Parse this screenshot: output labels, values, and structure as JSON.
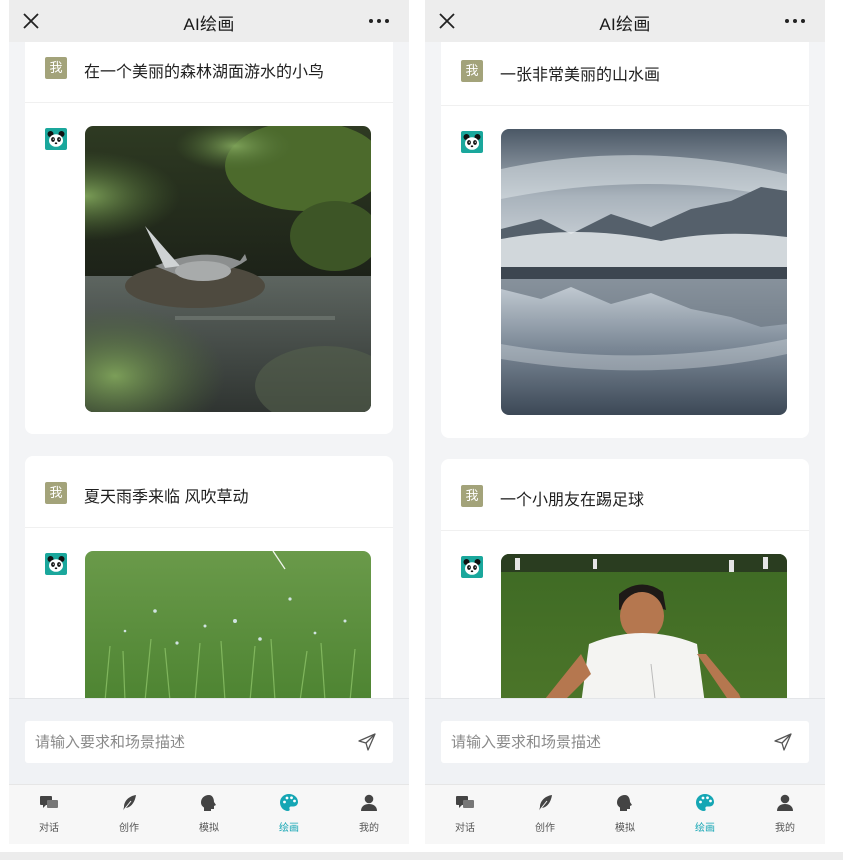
{
  "colors": {
    "accent": "#15a6b4",
    "user_avatar_bg": "#a3a37a",
    "bot_avatar_bg": "#1aa79c"
  },
  "screens": [
    {
      "header": {
        "title": "AI绘画",
        "close_icon": "close-icon",
        "more_icon": "more-dots-icon"
      },
      "messages": [
        {
          "sender": "我",
          "prompt": "在一个美丽的森林湖面游水的小鸟",
          "image": "bird-on-forest-lake"
        },
        {
          "sender": "我",
          "prompt": "夏天雨季来临 风吹草动",
          "image": "grass-in-rain"
        }
      ],
      "input": {
        "placeholder": "请输入要求和场景描述"
      },
      "tabs": [
        {
          "label": "对话",
          "icon": "chat-icon",
          "active": false
        },
        {
          "label": "创作",
          "icon": "feather-icon",
          "active": false
        },
        {
          "label": "模拟",
          "icon": "head-icon",
          "active": false
        },
        {
          "label": "绘画",
          "icon": "palette-icon",
          "active": true
        },
        {
          "label": "我的",
          "icon": "user-icon",
          "active": false
        }
      ]
    },
    {
      "header": {
        "title": "AI绘画",
        "close_icon": "close-icon",
        "more_icon": "more-dots-icon"
      },
      "messages": [
        {
          "sender": "我",
          "prompt": "一张非常美丽的山水画",
          "image": "misty-mountain-lake"
        },
        {
          "sender": "我",
          "prompt": "一个小朋友在踢足球",
          "image": "child-playing-football"
        }
      ],
      "input": {
        "placeholder": "请输入要求和场景描述"
      },
      "tabs": [
        {
          "label": "对话",
          "icon": "chat-icon",
          "active": false
        },
        {
          "label": "创作",
          "icon": "feather-icon",
          "active": false
        },
        {
          "label": "模拟",
          "icon": "head-icon",
          "active": false
        },
        {
          "label": "绘画",
          "icon": "palette-icon",
          "active": true
        },
        {
          "label": "我的",
          "icon": "user-icon",
          "active": false
        }
      ]
    }
  ]
}
